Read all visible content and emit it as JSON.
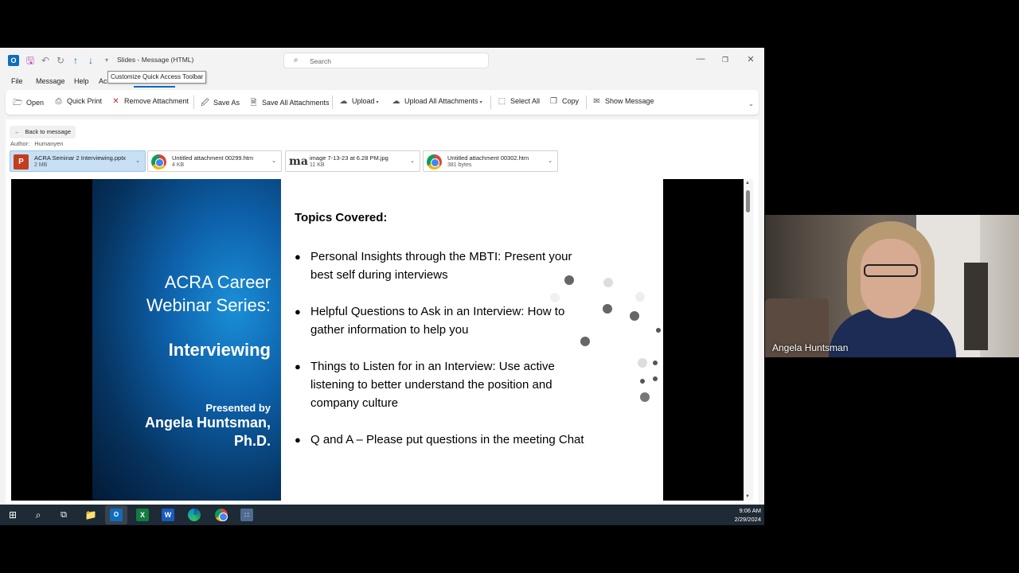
{
  "window": {
    "title": "Slides - Message (HTML)",
    "search_placeholder": "Search",
    "tooltip": "Customize Quick Access Toolbar",
    "menu": [
      "File",
      "Message",
      "Help",
      "Ac"
    ]
  },
  "ribbon": {
    "open": "Open",
    "quick_print": "Quick Print",
    "remove_attachment": "Remove Attachment",
    "save_as": "Save As",
    "save_all_attachments": "Save All Attachments",
    "upload": "Upload",
    "upload_all_attachments": "Upload All Attachments",
    "select_all": "Select All",
    "copy": "Copy",
    "show_message": "Show Message"
  },
  "pane": {
    "back": "Back to message",
    "author_label": "Author:",
    "author_value": "Humanyen"
  },
  "attachments": [
    {
      "name": "ACRA Seminar 2 Interviewing.pptx",
      "size": "2 MB"
    },
    {
      "name": "Untitled attachment 00299.htm",
      "size": "4 KB"
    },
    {
      "name": "image 7-13-23 at 6.28 PM.jpg",
      "size": "11 KB"
    },
    {
      "name": "Untitled attachment 00302.htm",
      "size": "381 bytes"
    }
  ],
  "slide": {
    "title_line1": "ACRA Career",
    "title_line2": "Webinar Series:",
    "title_line3": "Interviewing",
    "presented_by": "Presented by",
    "presenter_line1": "Angela Huntsman,",
    "presenter_line2": "Ph.D.",
    "topics_heading": "Topics Covered:",
    "bullets": [
      "Personal Insights through the MBTI: Present your best self during interviews",
      "Helpful Questions to Ask in an Interview: How to gather information to help you",
      "Things to Listen for in an Interview: Use active listening to better understand the position and company culture",
      "Q and A – Please put questions in the meeting Chat"
    ]
  },
  "taskbar": {
    "time": "9:06 AM",
    "date": "2/29/2024"
  },
  "webcam": {
    "name": "Angela Huntsman"
  }
}
